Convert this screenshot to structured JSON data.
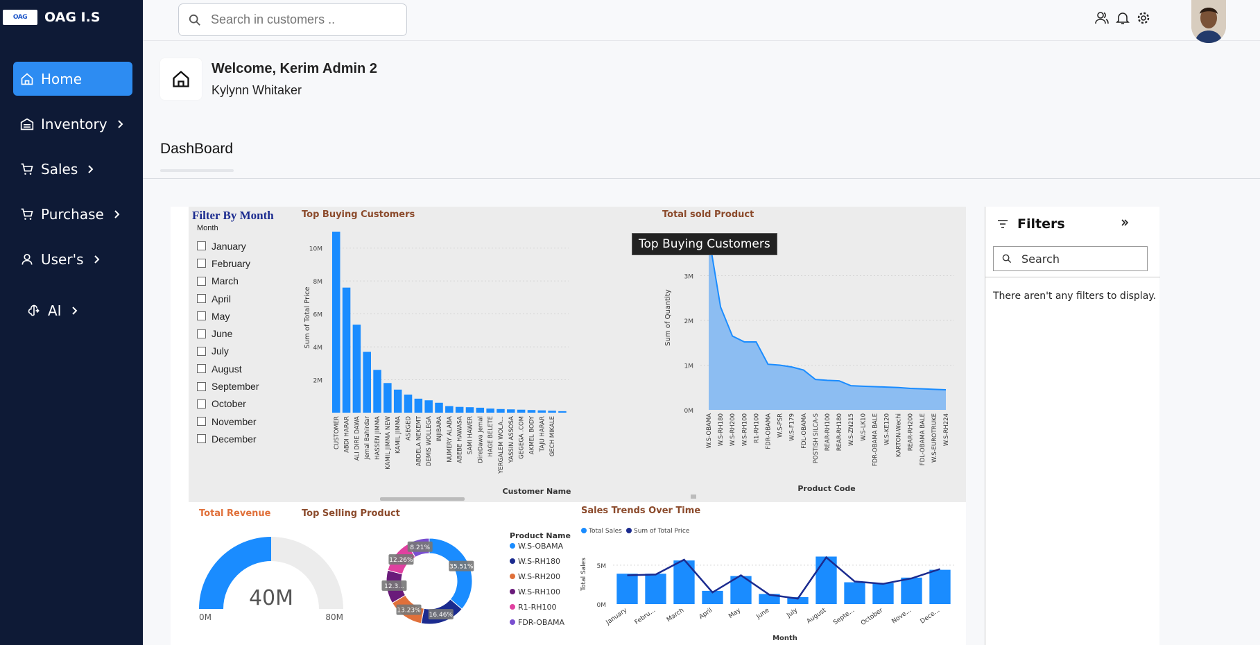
{
  "brand": {
    "logo_text": "OAG",
    "name": "OAG I.S"
  },
  "nav": [
    {
      "label": "Home",
      "icon": "home-icon",
      "active": true,
      "chevron": false
    },
    {
      "label": "Inventory",
      "icon": "warehouse-icon",
      "chevron": true
    },
    {
      "label": "Sales",
      "icon": "cart-icon",
      "chevron": true
    },
    {
      "label": "Purchase",
      "icon": "cart-icon",
      "chevron": true
    },
    {
      "label": "User's",
      "icon": "user-icon",
      "chevron": true
    },
    {
      "label": "AI",
      "icon": "brain-icon",
      "chevron": true
    }
  ],
  "search": {
    "placeholder": "Search in customers .."
  },
  "welcome": {
    "title": "Welcome, Kerim Admin 2",
    "subtitle": "Kylynn Whitaker"
  },
  "tab": {
    "label": "DashBoard"
  },
  "report": {
    "month_filter": {
      "title": "Filter By Month",
      "header": "Month",
      "months": [
        "January",
        "February",
        "March",
        "April",
        "May",
        "June",
        "July",
        "August",
        "September",
        "October",
        "November",
        "December"
      ]
    },
    "tooltip": "Top Buying Customers"
  },
  "filters_pane": {
    "title": "Filters",
    "search_placeholder": "Search",
    "empty_message": "There aren't any filters to display."
  },
  "colors": {
    "sidebar": "#0e1a36",
    "accent": "#2d8cf2",
    "bar": "#1a8cff",
    "navy": "#1b2b8f"
  },
  "chart_data": [
    {
      "type": "bar",
      "title": "Top Buying Customers",
      "xlabel": "Customer Name",
      "ylabel": "Sum of Total Price",
      "ylim": [
        0,
        11000000
      ],
      "yticks": [
        "2M",
        "4M",
        "6M",
        "8M",
        "10M"
      ],
      "categories": [
        "CUSTOMER",
        "ABDI HARAR",
        "ALI DIRE DAWA",
        "Jemal Bahirdar",
        "HASSEN JIMMA",
        "KAMIL JIMMA NEW",
        "KAMIL JIMMA",
        "ASEGED",
        "ABDELA NEKEMT",
        "DEMIS WOLLEGA",
        "INJIBARA",
        "NUMERY ALABA",
        "ABEBE HAWASA",
        "SAMI HAWER",
        "DireDawa Jemal",
        "HAGE BELETE",
        "YERGALEM WOLA...",
        "YASSIN ASSOSA",
        "GEGEGA .COM",
        "AKMEL BODY",
        "TAJU HARAR",
        "GECH MIKALE",
        ""
      ],
      "values": [
        11000000,
        7600000,
        5350000,
        3700000,
        2600000,
        1800000,
        1400000,
        1100000,
        850000,
        750000,
        600000,
        400000,
        350000,
        330000,
        300000,
        250000,
        220000,
        200000,
        180000,
        160000,
        140000,
        120000,
        90000
      ]
    },
    {
      "type": "area",
      "title": "Total sold Product",
      "xlabel": "Product Code",
      "ylabel": "Sum of Quantity",
      "ylim": [
        0,
        4000000
      ],
      "yticks": [
        "0M",
        "1M",
        "2M",
        "3M"
      ],
      "categories": [
        "W.S-OBAMA",
        "W.S-RH180",
        "W.S-RH200",
        "W.S-RH100",
        "R1-RH100",
        "FDR-OBAMA",
        "W.S-PSR",
        "W.S-F179",
        "FDL-OBAMA",
        "POSTISH SILCA-S",
        "REAR-RH100",
        "REAR-RH180",
        "W.S-ZN215",
        "W.S-LK10",
        "FDR-OBAMA BALE",
        "W.S-KE120",
        "KARTON-Wechi",
        "REAR-RH200",
        "FDL-OBAMA BALE",
        "W.S-EUROTRUKE",
        "W.S-RH224"
      ],
      "values": [
        3900000,
        2300000,
        1650000,
        1520000,
        1520000,
        1020000,
        1000000,
        960000,
        890000,
        680000,
        660000,
        650000,
        540000,
        530000,
        520000,
        510000,
        500000,
        480000,
        470000,
        460000,
        450000
      ]
    },
    {
      "type": "gauge",
      "title": "Total Revenue",
      "value": 40,
      "value_label": "40M",
      "min_label": "0M",
      "max_label": "80M",
      "min": 0,
      "max": 80
    },
    {
      "type": "pie",
      "title": "Top Selling Product",
      "legend_title": "Product Name",
      "labels": [
        "W.S-OBAMA",
        "W.S-RH180",
        "W.S-RH200",
        "W.S-RH100",
        "R1-RH100",
        "FDR-OBAMA"
      ],
      "values": [
        35.51,
        16.46,
        13.23,
        12.3,
        12.26,
        8.21
      ],
      "value_labels": [
        "35.51%",
        "16.46%",
        "13.23%",
        "12.3...",
        "12.26%",
        "8.21%"
      ],
      "colors": [
        "#1a8cff",
        "#1b2b8f",
        "#e0703a",
        "#6a1b7a",
        "#e040a0",
        "#7a4fd0"
      ]
    },
    {
      "type": "bar",
      "title": "Sales Trends Over Time",
      "xlabel": "Month",
      "ylabel": "Total Sales",
      "yticks": [
        "0M",
        "5M"
      ],
      "ylim": [
        0,
        6500000
      ],
      "categories": [
        "January",
        "Febru...",
        "March",
        "April",
        "May",
        "June",
        "July",
        "August",
        "Septe...",
        "October",
        "Nove...",
        "Dece..."
      ],
      "series": [
        {
          "name": "Total Sales",
          "type": "bar",
          "values": [
            3900000,
            3900000,
            5600000,
            1700000,
            3600000,
            1300000,
            900000,
            6100000,
            2800000,
            2700000,
            3400000,
            4400000
          ]
        },
        {
          "name": "Sum of Total Price",
          "type": "line",
          "values": [
            3700000,
            3800000,
            5700000,
            1500000,
            3700000,
            1200000,
            700000,
            6000000,
            2900000,
            2600000,
            3300000,
            4500000
          ]
        }
      ]
    }
  ]
}
